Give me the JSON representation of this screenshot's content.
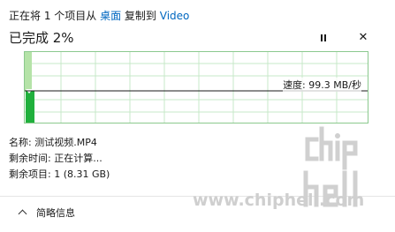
{
  "dialog": {
    "header": {
      "prefix": "正在将 1 个项目从 ",
      "source": "桌面",
      "middle": " 复制到 ",
      "destination": "Video"
    },
    "status": "已完成 2%",
    "progress_percent": 2,
    "controls": {
      "pause_icon": "pause-icon",
      "close_icon": "close-icon",
      "close_glyph": "✕"
    },
    "graph": {
      "speed_label": "速度: 99.3 MB/秒",
      "grid_color": "#c7e8c9",
      "fill_color": "#d7f0d2",
      "bar_color": "#20b03c"
    },
    "info": {
      "name": "名称: 测试视频.MP4",
      "time_remaining": "剩余时间: 正在计算...",
      "items_remaining": "剩余项目: 1 (8.31 GB)"
    },
    "footer": {
      "details_label": "简略信息"
    }
  },
  "watermark": {
    "url": "www.chiphell.com"
  }
}
